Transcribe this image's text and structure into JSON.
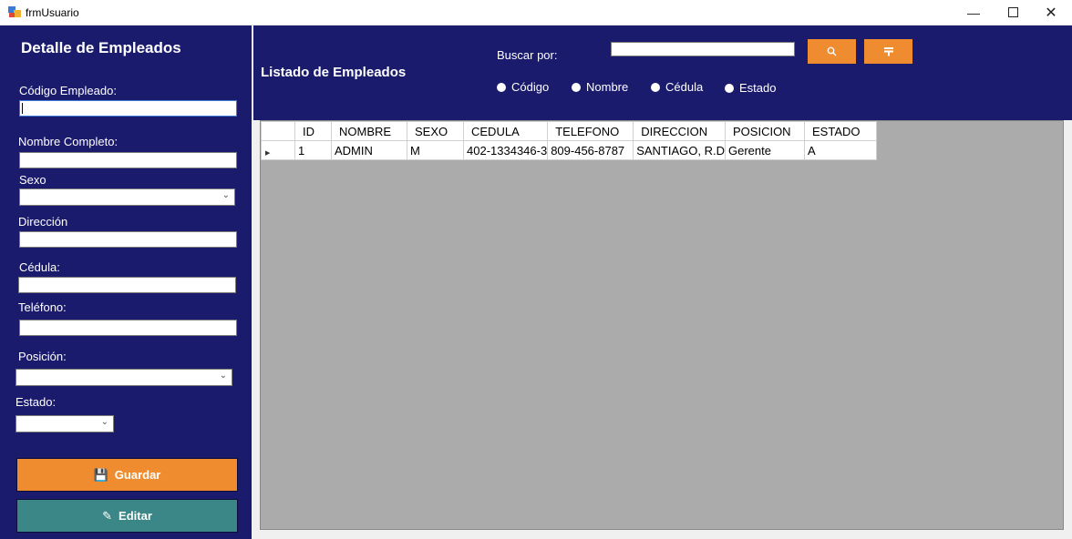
{
  "window": {
    "title": "frmUsuario",
    "controls": {
      "minimize": "—",
      "close": "✕"
    }
  },
  "detail_panel": {
    "title": "Detalle de Empleados",
    "fields": {
      "codigo_label": "Código Empleado:",
      "codigo_value": "",
      "nombre_label": "Nombre Completo:",
      "nombre_value": "",
      "sexo_label": "Sexo",
      "sexo_value": "",
      "direccion_label": "Dirección",
      "direccion_value": "",
      "cedula_label": "Cédula:",
      "cedula_value": "",
      "telefono_label": "Teléfono:",
      "telefono_value": "",
      "posicion_label": "Posición:",
      "posicion_value": "",
      "estado_label": "Estado:",
      "estado_value": ""
    },
    "buttons": {
      "guardar": "Guardar",
      "editar": "Editar"
    }
  },
  "list_panel": {
    "title": "Listado de Empleados",
    "search_label": "Buscar por:",
    "search_value": "",
    "radios": [
      "Código",
      "Nombre",
      "Cédula",
      "Estado"
    ]
  },
  "table": {
    "columns": [
      "ID",
      "NOMBRE",
      "SEXO",
      "CEDULA",
      "TELEFONO",
      "DIRECCION",
      "POSICION",
      "ESTADO"
    ],
    "rows": [
      [
        "1",
        "ADMIN",
        "M",
        "402-1334346-3",
        "809-456-8787",
        "SANTIAGO, R.D",
        "Gerente",
        "A"
      ]
    ]
  },
  "colors": {
    "panel_bg": "#1b1b6e",
    "accent_orange": "#ee8c2f",
    "accent_teal": "#3b8686",
    "grid_bg": "#ababab"
  },
  "icons": {
    "search": "search-icon",
    "filter": "filter-icon",
    "save": "save-icon",
    "edit": "edit-icon"
  }
}
